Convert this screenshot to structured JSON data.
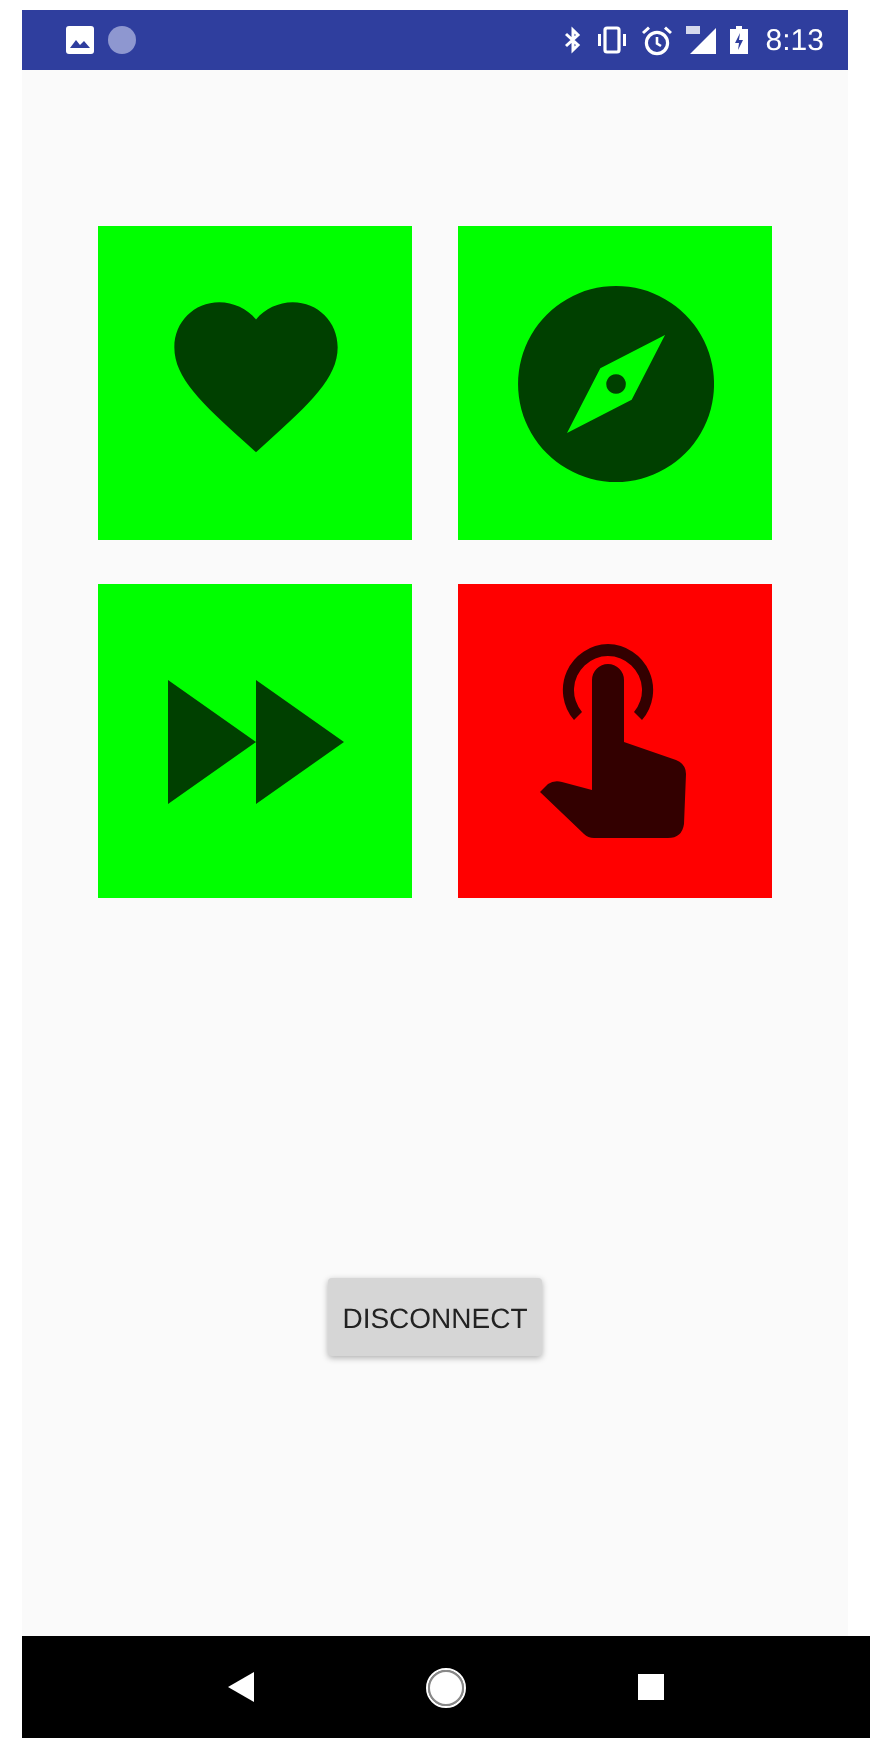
{
  "status_bar": {
    "time": "8:13"
  },
  "tiles": [
    {
      "kind": "heart",
      "color": "#00ff00"
    },
    {
      "kind": "compass",
      "color": "#00ff00"
    },
    {
      "kind": "fast-forward",
      "color": "#00ff00"
    },
    {
      "kind": "touch",
      "color": "#ff0000"
    }
  ],
  "buttons": [
    "DISCONNECT"
  ]
}
